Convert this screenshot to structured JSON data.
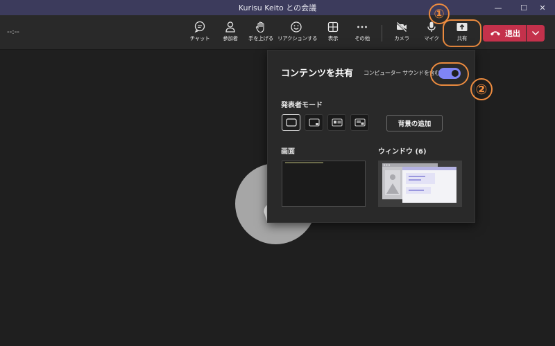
{
  "window": {
    "title": "Kurisu Keito との会議",
    "minimize_glyph": "—",
    "maximize_glyph": "☐",
    "close_glyph": "✕"
  },
  "toolbar": {
    "timer": "--:--",
    "chat": "チャット",
    "participants": "参加者",
    "raise_hand": "手を上げる",
    "reactions": "リアクションする",
    "view": "表示",
    "more": "その他",
    "camera": "カメラ",
    "mic": "マイク",
    "share": "共有",
    "leave": "退出"
  },
  "callouts": {
    "one": "①",
    "two": "②"
  },
  "share_panel": {
    "title": "コンテンツを共有",
    "include_audio_label": "コンピューター サウンドを含む",
    "include_audio_on": true,
    "presenter_mode_label": "発表者モード",
    "add_background_button": "背景の追加",
    "screen_label": "画面",
    "window_label": "ウィンドウ (6)"
  },
  "colors": {
    "title_bar": "#3c3b5c",
    "accent": "#7f85f5",
    "leave": "#c4314b",
    "callout": "#ec8b3f"
  }
}
